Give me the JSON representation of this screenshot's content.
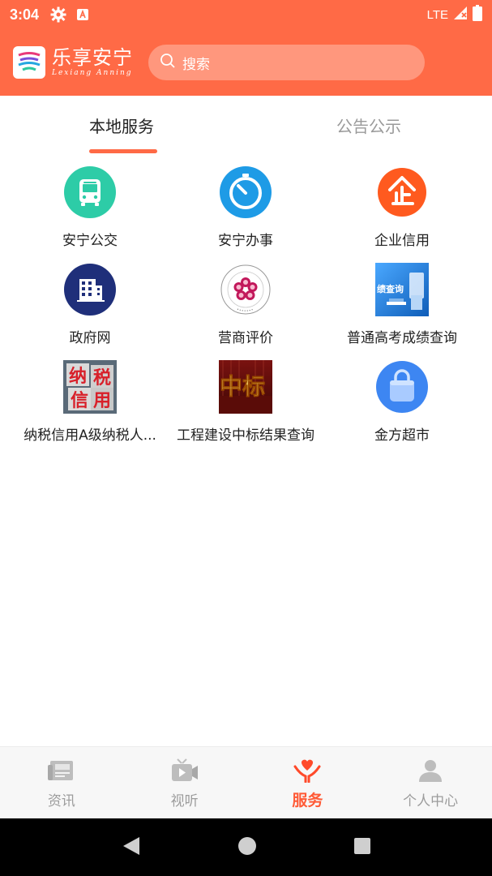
{
  "status_bar": {
    "time": "3:04",
    "network": "LTE",
    "icons": [
      "gear-icon",
      "font-icon",
      "signal-icon",
      "battery-icon"
    ]
  },
  "header": {
    "app_name": "乐享安宁",
    "app_name_sub": "Lexiang Anning",
    "search_placeholder": "搜索",
    "brand_color": "#FF6A46"
  },
  "tabs": [
    {
      "label": "本地服务",
      "active": true
    },
    {
      "label": "公告公示",
      "active": false
    }
  ],
  "services": [
    {
      "label": "安宁公交",
      "icon": "bus-icon",
      "color": "#2DCCA7"
    },
    {
      "label": "安宁办事",
      "icon": "timer-icon",
      "color": "#1E9BE6"
    },
    {
      "label": "企业信用",
      "icon": "enterprise-icon",
      "color": "#FF5A1F"
    },
    {
      "label": "政府网",
      "icon": "building-icon",
      "color": "#1F2F7A"
    },
    {
      "label": "营商评价",
      "icon": "flower-seal-icon",
      "seal_text": "安宁政务服务"
    },
    {
      "label": "普通高考成绩查询",
      "icon": "exam-score-icon",
      "image_text": "绩查询"
    },
    {
      "label": "纳税信用A级纳税人...",
      "icon": "tax-credit-icon",
      "image_text": [
        "纳",
        "税",
        "信",
        "用"
      ]
    },
    {
      "label": "工程建设中标结果查询",
      "icon": "bid-result-icon",
      "image_text": "中标"
    },
    {
      "label": "金方超市",
      "icon": "shopping-bag-icon",
      "color": "#3D86F2"
    }
  ],
  "bottom_nav": [
    {
      "label": "资讯",
      "icon": "news-icon",
      "active": false
    },
    {
      "label": "视听",
      "icon": "video-icon",
      "active": false
    },
    {
      "label": "服务",
      "icon": "service-heart-icon",
      "active": true
    },
    {
      "label": "个人中心",
      "icon": "person-icon",
      "active": false
    }
  ],
  "system_nav": [
    "back-icon",
    "home-icon",
    "recents-icon"
  ]
}
